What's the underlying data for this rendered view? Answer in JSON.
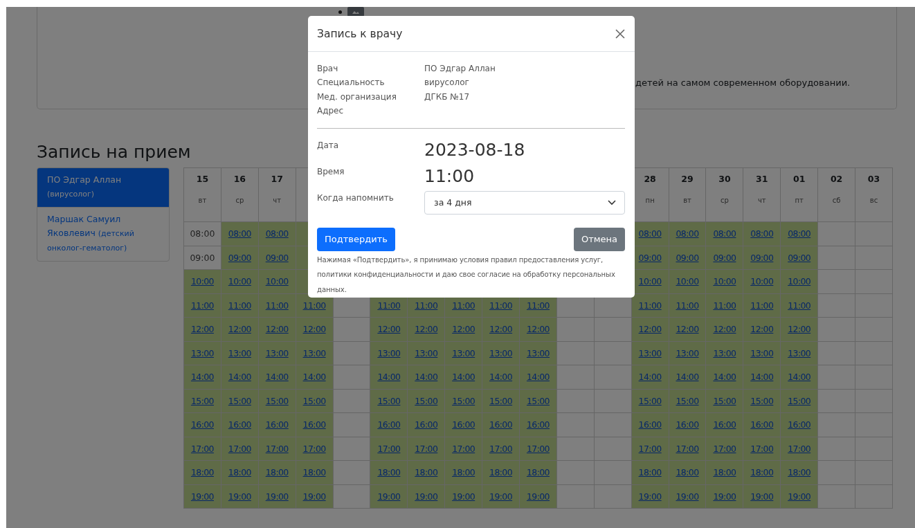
{
  "info_card": {
    "text": "детей на самом современном оборудовании."
  },
  "booking": {
    "heading": "Запись на прием",
    "doctors": [
      {
        "name": "ПО Эдгар Аллан",
        "specialty": "(вирусолог)",
        "selected": true
      },
      {
        "name": "Маршак Самуил Яковлевич",
        "specialty": "(детский онколог-гематолог)",
        "selected": false
      }
    ],
    "columns": [
      {
        "day": "15",
        "weekday": "вт",
        "slots": [
          {
            "time": "08:00",
            "kind": "past"
          },
          {
            "time": "09:00",
            "kind": "past"
          },
          {
            "time": "10:00",
            "kind": "open"
          },
          {
            "time": "11:00",
            "kind": "open"
          },
          {
            "time": "12:00",
            "kind": "open"
          },
          {
            "time": "13:00",
            "kind": "open"
          },
          {
            "time": "14:00",
            "kind": "open"
          },
          {
            "time": "15:00",
            "kind": "open"
          },
          {
            "time": "16:00",
            "kind": "open"
          },
          {
            "time": "17:00",
            "kind": "open"
          },
          {
            "time": "18:00",
            "kind": "open"
          },
          {
            "time": "19:00",
            "kind": "open"
          }
        ]
      },
      {
        "day": "16",
        "weekday": "ср",
        "slots": [
          {
            "time": "08:00",
            "kind": "open"
          },
          {
            "time": "09:00",
            "kind": "open"
          },
          {
            "time": "10:00",
            "kind": "open"
          },
          {
            "time": "11:00",
            "kind": "open"
          },
          {
            "time": "12:00",
            "kind": "open"
          },
          {
            "time": "13:00",
            "kind": "open"
          },
          {
            "time": "14:00",
            "kind": "open"
          },
          {
            "time": "15:00",
            "kind": "open"
          },
          {
            "time": "16:00",
            "kind": "open"
          },
          {
            "time": "17:00",
            "kind": "open"
          },
          {
            "time": "18:00",
            "kind": "open"
          },
          {
            "time": "19:00",
            "kind": "open"
          }
        ]
      },
      {
        "day": "17",
        "weekday": "чт",
        "slots": [
          {
            "time": "08:00",
            "kind": "open"
          },
          {
            "time": "09:00",
            "kind": "open"
          },
          {
            "time": "10:00",
            "kind": "open"
          },
          {
            "time": "11:00",
            "kind": "open"
          },
          {
            "time": "12:00",
            "kind": "open"
          },
          {
            "time": "13:00",
            "kind": "open"
          },
          {
            "time": "14:00",
            "kind": "open"
          },
          {
            "time": "15:00",
            "kind": "open"
          },
          {
            "time": "16:00",
            "kind": "open"
          },
          {
            "time": "17:00",
            "kind": "open"
          },
          {
            "time": "18:00",
            "kind": "open"
          },
          {
            "time": "19:00",
            "kind": "open"
          }
        ]
      },
      {
        "slots": [
          {
            "kind": "open"
          },
          {
            "kind": "open"
          },
          {
            "kind": "open"
          },
          {
            "time": "11:00",
            "kind": "open"
          },
          {
            "time": "12:00",
            "kind": "open"
          },
          {
            "time": "13:00",
            "kind": "open"
          },
          {
            "time": "14:00",
            "kind": "open"
          },
          {
            "time": "15:00",
            "kind": "open"
          },
          {
            "time": "16:00",
            "kind": "open"
          },
          {
            "time": "17:00",
            "kind": "open"
          },
          {
            "time": "18:00",
            "kind": "open"
          },
          {
            "time": "19:00",
            "kind": "open"
          }
        ]
      },
      {
        "slots": [
          {
            "kind": "covered"
          },
          {
            "kind": "covered"
          },
          {
            "kind": "covered"
          },
          {
            "kind": "none"
          },
          {
            "kind": "none"
          },
          {
            "kind": "none"
          },
          {
            "kind": "none"
          },
          {
            "kind": "none"
          },
          {
            "kind": "none"
          },
          {
            "kind": "none"
          },
          {
            "kind": "none"
          },
          {
            "kind": "none"
          }
        ]
      },
      {
        "slots": [
          {
            "kind": "covered"
          },
          {
            "kind": "covered"
          },
          {
            "kind": "covered"
          },
          {
            "time": "11:00",
            "kind": "open"
          },
          {
            "time": "12:00",
            "kind": "open"
          },
          {
            "time": "13:00",
            "kind": "open"
          },
          {
            "time": "14:00",
            "kind": "open"
          },
          {
            "time": "15:00",
            "kind": "open"
          },
          {
            "time": "16:00",
            "kind": "open"
          },
          {
            "time": "17:00",
            "kind": "open"
          },
          {
            "time": "18:00",
            "kind": "open"
          },
          {
            "time": "19:00",
            "kind": "open"
          }
        ]
      },
      {
        "slots": [
          {
            "kind": "covered"
          },
          {
            "kind": "covered"
          },
          {
            "kind": "covered"
          },
          {
            "time": "11:00",
            "kind": "open"
          },
          {
            "time": "12:00",
            "kind": "open"
          },
          {
            "time": "13:00",
            "kind": "open"
          },
          {
            "time": "14:00",
            "kind": "open"
          },
          {
            "time": "15:00",
            "kind": "open"
          },
          {
            "time": "16:00",
            "kind": "open"
          },
          {
            "time": "17:00",
            "kind": "open"
          },
          {
            "time": "18:00",
            "kind": "open"
          },
          {
            "time": "19:00",
            "kind": "open"
          }
        ]
      },
      {
        "slots": [
          {
            "kind": "covered"
          },
          {
            "kind": "covered"
          },
          {
            "kind": "covered"
          },
          {
            "time": "11:00",
            "kind": "open"
          },
          {
            "time": "12:00",
            "kind": "open"
          },
          {
            "time": "13:00",
            "kind": "open"
          },
          {
            "time": "14:00",
            "kind": "open"
          },
          {
            "time": "15:00",
            "kind": "open"
          },
          {
            "time": "16:00",
            "kind": "open"
          },
          {
            "time": "17:00",
            "kind": "open"
          },
          {
            "time": "18:00",
            "kind": "open"
          },
          {
            "time": "19:00",
            "kind": "open"
          }
        ]
      },
      {
        "slots": [
          {
            "kind": "covered"
          },
          {
            "kind": "covered"
          },
          {
            "kind": "covered"
          },
          {
            "time": "11:00",
            "kind": "open"
          },
          {
            "time": "12:00",
            "kind": "open"
          },
          {
            "time": "13:00",
            "kind": "open"
          },
          {
            "time": "14:00",
            "kind": "open"
          },
          {
            "time": "15:00",
            "kind": "open"
          },
          {
            "time": "16:00",
            "kind": "open"
          },
          {
            "time": "17:00",
            "kind": "open"
          },
          {
            "time": "18:00",
            "kind": "open"
          },
          {
            "time": "19:00",
            "kind": "open"
          }
        ]
      },
      {
        "slots": [
          {
            "kind": "covered"
          },
          {
            "kind": "covered"
          },
          {
            "kind": "covered"
          },
          {
            "time": "11:00",
            "kind": "open"
          },
          {
            "time": "12:00",
            "kind": "open"
          },
          {
            "time": "13:00",
            "kind": "open"
          },
          {
            "time": "14:00",
            "kind": "open"
          },
          {
            "time": "15:00",
            "kind": "open"
          },
          {
            "time": "16:00",
            "kind": "open"
          },
          {
            "time": "17:00",
            "kind": "open"
          },
          {
            "time": "18:00",
            "kind": "open"
          },
          {
            "time": "19:00",
            "kind": "open"
          }
        ]
      },
      {
        "slots": [
          {
            "kind": "covered"
          },
          {
            "kind": "covered"
          },
          {
            "kind": "covered"
          },
          {
            "kind": "none"
          },
          {
            "kind": "none"
          },
          {
            "kind": "none"
          },
          {
            "kind": "none"
          },
          {
            "kind": "none"
          },
          {
            "kind": "none"
          },
          {
            "kind": "none"
          },
          {
            "kind": "none"
          },
          {
            "kind": "none"
          }
        ]
      },
      {
        "slots": [
          {
            "kind": "covered"
          },
          {
            "kind": "covered"
          },
          {
            "kind": "covered"
          },
          {
            "kind": "none"
          },
          {
            "kind": "none"
          },
          {
            "kind": "none"
          },
          {
            "kind": "none"
          },
          {
            "kind": "none"
          },
          {
            "kind": "none"
          },
          {
            "kind": "none"
          },
          {
            "kind": "none"
          },
          {
            "kind": "none"
          }
        ]
      },
      {
        "day": "28",
        "weekday": "пн",
        "slots": [
          {
            "time": "08:00",
            "kind": "open"
          },
          {
            "time": "09:00",
            "kind": "open"
          },
          {
            "time": "10:00",
            "kind": "open"
          },
          {
            "time": "11:00",
            "kind": "open"
          },
          {
            "time": "12:00",
            "kind": "open"
          },
          {
            "time": "13:00",
            "kind": "open"
          },
          {
            "time": "14:00",
            "kind": "open"
          },
          {
            "time": "15:00",
            "kind": "open"
          },
          {
            "time": "16:00",
            "kind": "open"
          },
          {
            "time": "17:00",
            "kind": "open"
          },
          {
            "time": "18:00",
            "kind": "open"
          },
          {
            "time": "19:00",
            "kind": "open"
          }
        ]
      },
      {
        "day": "29",
        "weekday": "вт",
        "slots": [
          {
            "time": "08:00",
            "kind": "open"
          },
          {
            "time": "09:00",
            "kind": "open"
          },
          {
            "time": "10:00",
            "kind": "open"
          },
          {
            "time": "11:00",
            "kind": "open"
          },
          {
            "time": "12:00",
            "kind": "open"
          },
          {
            "time": "13:00",
            "kind": "open"
          },
          {
            "time": "14:00",
            "kind": "open"
          },
          {
            "time": "15:00",
            "kind": "open"
          },
          {
            "time": "16:00",
            "kind": "open"
          },
          {
            "time": "17:00",
            "kind": "open"
          },
          {
            "time": "18:00",
            "kind": "open"
          },
          {
            "time": "19:00",
            "kind": "open"
          }
        ]
      },
      {
        "day": "30",
        "weekday": "ср",
        "slots": [
          {
            "time": "08:00",
            "kind": "open"
          },
          {
            "time": "09:00",
            "kind": "open"
          },
          {
            "time": "10:00",
            "kind": "open"
          },
          {
            "time": "11:00",
            "kind": "open"
          },
          {
            "time": "12:00",
            "kind": "open"
          },
          {
            "time": "13:00",
            "kind": "open"
          },
          {
            "time": "14:00",
            "kind": "open"
          },
          {
            "time": "15:00",
            "kind": "open"
          },
          {
            "time": "16:00",
            "kind": "open"
          },
          {
            "time": "17:00",
            "kind": "open"
          },
          {
            "time": "18:00",
            "kind": "open"
          },
          {
            "time": "19:00",
            "kind": "open"
          }
        ]
      },
      {
        "day": "31",
        "weekday": "чт",
        "slots": [
          {
            "time": "08:00",
            "kind": "open"
          },
          {
            "time": "09:00",
            "kind": "open"
          },
          {
            "time": "10:00",
            "kind": "open"
          },
          {
            "time": "11:00",
            "kind": "open"
          },
          {
            "time": "12:00",
            "kind": "open"
          },
          {
            "time": "13:00",
            "kind": "open"
          },
          {
            "time": "14:00",
            "kind": "open"
          },
          {
            "time": "15:00",
            "kind": "open"
          },
          {
            "time": "16:00",
            "kind": "open"
          },
          {
            "time": "17:00",
            "kind": "open"
          },
          {
            "time": "18:00",
            "kind": "open"
          },
          {
            "time": "19:00",
            "kind": "open"
          }
        ]
      },
      {
        "day": "01",
        "weekday": "пт",
        "slots": [
          {
            "time": "08:00",
            "kind": "open"
          },
          {
            "time": "09:00",
            "kind": "open"
          },
          {
            "time": "10:00",
            "kind": "open"
          },
          {
            "time": "11:00",
            "kind": "open"
          },
          {
            "time": "12:00",
            "kind": "open"
          },
          {
            "time": "13:00",
            "kind": "open"
          },
          {
            "time": "14:00",
            "kind": "open"
          },
          {
            "time": "15:00",
            "kind": "open"
          },
          {
            "time": "16:00",
            "kind": "open"
          },
          {
            "time": "17:00",
            "kind": "open"
          },
          {
            "time": "18:00",
            "kind": "open"
          },
          {
            "time": "19:00",
            "kind": "open"
          }
        ]
      },
      {
        "day": "02",
        "weekday": "сб",
        "slots": [
          {
            "kind": "none"
          },
          {
            "kind": "none"
          },
          {
            "kind": "none"
          },
          {
            "kind": "none"
          },
          {
            "kind": "none"
          },
          {
            "kind": "none"
          },
          {
            "kind": "none"
          },
          {
            "kind": "none"
          },
          {
            "kind": "none"
          },
          {
            "kind": "none"
          },
          {
            "kind": "none"
          },
          {
            "kind": "none"
          }
        ]
      },
      {
        "day": "03",
        "weekday": "вс",
        "slots": [
          {
            "kind": "none"
          },
          {
            "kind": "none"
          },
          {
            "kind": "none"
          },
          {
            "kind": "none"
          },
          {
            "kind": "none"
          },
          {
            "kind": "none"
          },
          {
            "kind": "none"
          },
          {
            "kind": "none"
          },
          {
            "kind": "none"
          },
          {
            "kind": "none"
          },
          {
            "kind": "none"
          },
          {
            "kind": "none"
          }
        ]
      }
    ]
  },
  "modal": {
    "title": "Запись к врачу",
    "details": [
      {
        "label": "Врач",
        "value": "ПО Эдгар Аллан"
      },
      {
        "label": "Специальность",
        "value": "вирусолог"
      },
      {
        "label": "Мед. организация",
        "value": "ДГКБ №17"
      },
      {
        "label": "Адрес"
      }
    ],
    "date": {
      "label": "Дата",
      "value": "2023-08-18"
    },
    "time": {
      "label": "Время",
      "value": "11:00"
    },
    "reminder": {
      "label": "Когда напомнить",
      "value": "за 4 дня"
    },
    "confirm_button": "Подтвердить",
    "cancel_button": "Отмена",
    "disclaimer": "Нажимая «Подтвердить», я принимаю условия правил предоставления услуг, политики конфиденциальности и даю свое согласие на обработку персональных данных."
  }
}
